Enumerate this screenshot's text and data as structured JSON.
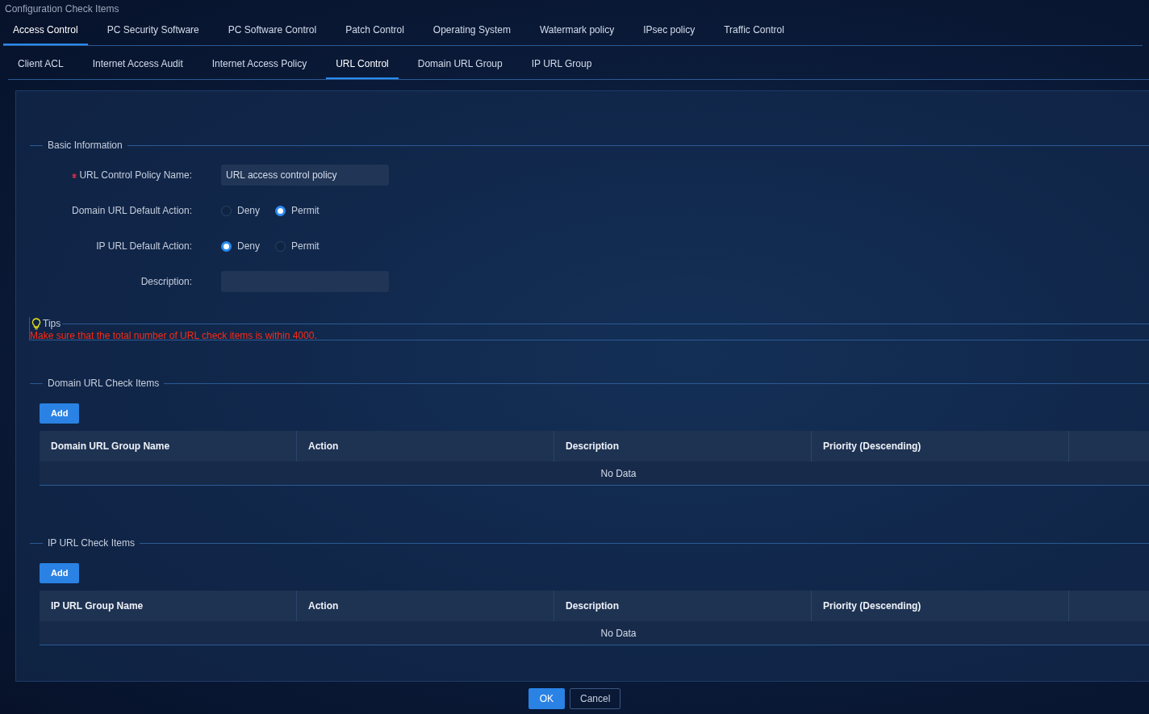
{
  "window": {
    "title": "Configuration Check Items"
  },
  "tabs": [
    {
      "label": "Access Control",
      "selected": true
    },
    {
      "label": "PC Security Software",
      "selected": false
    },
    {
      "label": "PC Software Control",
      "selected": false
    },
    {
      "label": "Patch Control",
      "selected": false
    },
    {
      "label": "Operating System",
      "selected": false
    },
    {
      "label": "Watermark policy",
      "selected": false
    },
    {
      "label": "IPsec policy",
      "selected": false
    },
    {
      "label": "Traffic Control",
      "selected": false
    }
  ],
  "subtabs": [
    {
      "label": "Client ACL",
      "selected": false
    },
    {
      "label": "Internet Access Audit",
      "selected": false
    },
    {
      "label": "Internet Access Policy",
      "selected": false
    },
    {
      "label": "URL Control",
      "selected": true
    },
    {
      "label": "Domain URL Group",
      "selected": false
    },
    {
      "label": "IP URL Group",
      "selected": false
    }
  ],
  "basic_information": {
    "title": "Basic Information",
    "fields": [
      {
        "kind": "text",
        "label": "URL Control Policy Name:",
        "required": true,
        "value": "URL access control policy"
      },
      {
        "kind": "radio",
        "label": "Domain URL Default Action:",
        "options": [
          {
            "label": "Deny",
            "selected": false
          },
          {
            "label": "Permit",
            "selected": true
          }
        ]
      },
      {
        "kind": "radio",
        "label": "IP URL Default Action:",
        "options": [
          {
            "label": "Deny",
            "selected": true
          },
          {
            "label": "Permit",
            "selected": false
          }
        ]
      },
      {
        "kind": "text",
        "label": "Description:",
        "required": false
      }
    ]
  },
  "tips": {
    "title": "Tips",
    "text": "Make sure that the total number of URL check items is within 4000."
  },
  "sections": [
    {
      "title": "Domain URL Check Items",
      "button": "Add",
      "columns": [
        "Domain URL Group Name",
        "Action",
        "Description",
        "Priority (Descending)"
      ],
      "empty_text": "No Data"
    },
    {
      "title": "IP URL Check Items",
      "button": "Add",
      "columns": [
        "IP URL Group Name",
        "Action",
        "Description",
        "Priority (Descending)"
      ],
      "empty_text": "No Data"
    }
  ],
  "buttons": [
    {
      "kind": "primary",
      "label": "OK"
    },
    {
      "kind": "secondary",
      "label": "Cancel"
    }
  ]
}
